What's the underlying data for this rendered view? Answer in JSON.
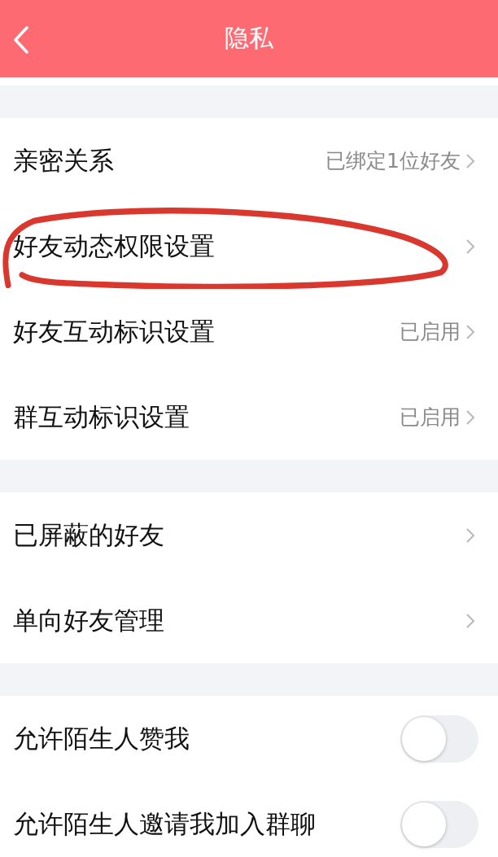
{
  "header": {
    "title": "隐私"
  },
  "sections": [
    {
      "rows": [
        {
          "kind": "link",
          "label": "亲密关系",
          "value": "已绑定1位好友",
          "circled": false
        },
        {
          "kind": "link",
          "label": "好友动态权限设置",
          "circled": true
        },
        {
          "kind": "link",
          "label": "好友互动标识设置",
          "value": "已启用",
          "circled": false
        },
        {
          "kind": "link",
          "label": "群互动标识设置",
          "value": "已启用",
          "circled": false
        }
      ]
    },
    {
      "rows": [
        {
          "kind": "link",
          "label": "已屏蔽的好友",
          "circled": false
        },
        {
          "kind": "link",
          "label": "单向好友管理",
          "circled": false
        }
      ]
    },
    {
      "rows": [
        {
          "kind": "toggle",
          "label": "允许陌生人赞我",
          "on": false,
          "circled": false
        },
        {
          "kind": "toggle",
          "label": "允许陌生人邀请我加入群聊",
          "on": false,
          "circled": false
        }
      ]
    }
  ]
}
